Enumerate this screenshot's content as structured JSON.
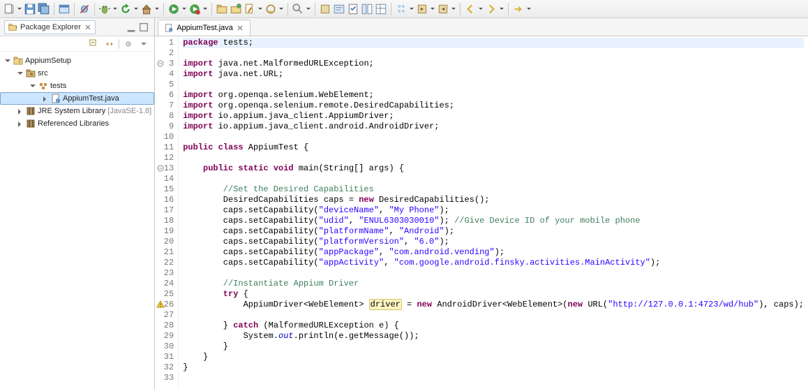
{
  "explorer": {
    "title": "Package Explorer",
    "tree": {
      "project": "AppiumSetup",
      "src": "src",
      "pkg": "tests",
      "file": "AppiumTest.java",
      "jre": "JRE System Library",
      "jre_decor": " [JavaSE-1.8]",
      "reflib": "Referenced Libraries"
    }
  },
  "editor": {
    "tab_label": "AppiumTest.java",
    "lines": [
      {
        "n": 1,
        "hl": true,
        "t": [
          [
            "kw",
            "package"
          ],
          [
            "",
            " tests;"
          ]
        ]
      },
      {
        "n": 2,
        "t": [
          [
            "",
            ""
          ]
        ]
      },
      {
        "n": 3,
        "mark": "fold",
        "t": [
          [
            "kw",
            "import"
          ],
          [
            "",
            " java.net.MalformedURLException;"
          ]
        ]
      },
      {
        "n": 4,
        "t": [
          [
            "kw",
            "import"
          ],
          [
            "",
            " java.net.URL;"
          ]
        ]
      },
      {
        "n": 5,
        "t": [
          [
            "",
            ""
          ]
        ]
      },
      {
        "n": 6,
        "t": [
          [
            "kw",
            "import"
          ],
          [
            "",
            " org.openqa.selenium.WebElement;"
          ]
        ]
      },
      {
        "n": 7,
        "t": [
          [
            "kw",
            "import"
          ],
          [
            "",
            " org.openqa.selenium.remote.DesiredCapabilities;"
          ]
        ]
      },
      {
        "n": 8,
        "t": [
          [
            "kw",
            "import"
          ],
          [
            "",
            " io.appium.java_client.AppiumDriver;"
          ]
        ]
      },
      {
        "n": 9,
        "t": [
          [
            "kw",
            "import"
          ],
          [
            "",
            " io.appium.java_client.android.AndroidDriver;"
          ]
        ]
      },
      {
        "n": 10,
        "t": [
          [
            "",
            ""
          ]
        ]
      },
      {
        "n": 11,
        "t": [
          [
            "kw",
            "public class"
          ],
          [
            "",
            " AppiumTest {"
          ]
        ]
      },
      {
        "n": 12,
        "t": [
          [
            "",
            ""
          ]
        ]
      },
      {
        "n": 13,
        "mark": "fold",
        "t": [
          [
            "",
            "    "
          ],
          [
            "kw",
            "public static void"
          ],
          [
            "",
            " main(String[] args) {"
          ]
        ]
      },
      {
        "n": 14,
        "t": [
          [
            "",
            ""
          ]
        ]
      },
      {
        "n": 15,
        "t": [
          [
            "",
            "        "
          ],
          [
            "cmt",
            "//Set the Desired Capabilities"
          ]
        ]
      },
      {
        "n": 16,
        "t": [
          [
            "",
            "        DesiredCapabilities caps = "
          ],
          [
            "kw",
            "new"
          ],
          [
            "",
            " DesiredCapabilities();"
          ]
        ]
      },
      {
        "n": 17,
        "t": [
          [
            "",
            "        caps.setCapability("
          ],
          [
            "str",
            "\"deviceName\""
          ],
          [
            "",
            ", "
          ],
          [
            "str",
            "\"My Phone\""
          ],
          [
            "",
            ");"
          ]
        ]
      },
      {
        "n": 18,
        "t": [
          [
            "",
            "        caps.setCapability("
          ],
          [
            "str",
            "\"udid\""
          ],
          [
            "",
            ", "
          ],
          [
            "str",
            "\"ENUL6303030010\""
          ],
          [
            "",
            "); "
          ],
          [
            "cmt",
            "//Give Device ID of your mobile phone"
          ]
        ]
      },
      {
        "n": 19,
        "t": [
          [
            "",
            "        caps.setCapability("
          ],
          [
            "str",
            "\"platformName\""
          ],
          [
            "",
            ", "
          ],
          [
            "str",
            "\"Android\""
          ],
          [
            "",
            ");"
          ]
        ]
      },
      {
        "n": 20,
        "t": [
          [
            "",
            "        caps.setCapability("
          ],
          [
            "str",
            "\"platformVersion\""
          ],
          [
            "",
            ", "
          ],
          [
            "str",
            "\"6.0\""
          ],
          [
            "",
            ");"
          ]
        ]
      },
      {
        "n": 21,
        "t": [
          [
            "",
            "        caps.setCapability("
          ],
          [
            "str",
            "\"appPackage\""
          ],
          [
            "",
            ", "
          ],
          [
            "str",
            "\"com.android.vending\""
          ],
          [
            "",
            ");"
          ]
        ]
      },
      {
        "n": 22,
        "t": [
          [
            "",
            "        caps.setCapability("
          ],
          [
            "str",
            "\"appActivity\""
          ],
          [
            "",
            ", "
          ],
          [
            "str",
            "\"com.google.android.finsky.activities.MainActivity\""
          ],
          [
            "",
            ");"
          ]
        ]
      },
      {
        "n": 23,
        "t": [
          [
            "",
            ""
          ]
        ]
      },
      {
        "n": 24,
        "t": [
          [
            "",
            "        "
          ],
          [
            "cmt",
            "//Instantiate Appium Driver"
          ]
        ]
      },
      {
        "n": 25,
        "t": [
          [
            "",
            "        "
          ],
          [
            "kw",
            "try"
          ],
          [
            "",
            " {"
          ]
        ]
      },
      {
        "n": 26,
        "mark": "warn",
        "t": [
          [
            "",
            "            AppiumDriver<WebElement> "
          ],
          [
            "hl-w",
            "driver"
          ],
          [
            "",
            " = "
          ],
          [
            "kw",
            "new"
          ],
          [
            "",
            " AndroidDriver<WebElement>("
          ],
          [
            "kw",
            "new"
          ],
          [
            "",
            " URL("
          ],
          [
            "str",
            "\"http://127.0.0.1:4723/wd/hub\""
          ],
          [
            "",
            "), caps);"
          ]
        ]
      },
      {
        "n": 27,
        "t": [
          [
            "",
            ""
          ]
        ]
      },
      {
        "n": 28,
        "t": [
          [
            "",
            "        } "
          ],
          [
            "kw",
            "catch"
          ],
          [
            "",
            " (MalformedURLException e) {"
          ]
        ]
      },
      {
        "n": 29,
        "t": [
          [
            "",
            "            System."
          ],
          [
            "fld",
            "out"
          ],
          [
            "",
            ".println(e.getMessage());"
          ]
        ]
      },
      {
        "n": 30,
        "t": [
          [
            "",
            "        }"
          ]
        ]
      },
      {
        "n": 31,
        "t": [
          [
            "",
            "    }"
          ]
        ]
      },
      {
        "n": 32,
        "t": [
          [
            "",
            "}"
          ]
        ]
      },
      {
        "n": 33,
        "t": [
          [
            "",
            ""
          ]
        ]
      }
    ]
  }
}
